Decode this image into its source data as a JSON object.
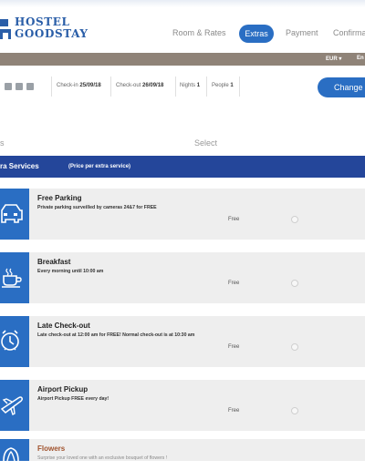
{
  "brand": {
    "line1": "HOSTEL",
    "line2": "GOODSTAY",
    "color": "#2a5ea8"
  },
  "nav": {
    "rooms": "Room & Rates",
    "extras": "Extras",
    "payment": "Payment",
    "confirm": "Confirma"
  },
  "topbar": {
    "currency": "EUR ▾",
    "language": "En"
  },
  "booking": {
    "checkin_label": "Check-in",
    "checkin_value": "25/09/18",
    "checkout_label": "Check-out",
    "checkout_value": "26/09/18",
    "nights_label": "Nights",
    "nights_value": "1",
    "people_label": "People",
    "people_value": "1",
    "change_label": "Change"
  },
  "columns": {
    "left": "s",
    "select": "Select"
  },
  "section": {
    "title": "ra Services",
    "subtitle": "(Price per extra service)"
  },
  "services": [
    {
      "icon": "car-icon",
      "title": "Free Parking",
      "desc": "Private parking surveilled by cameras 24&7 for FREE",
      "price": "Free"
    },
    {
      "icon": "coffee-icon",
      "title": "Breakfast",
      "desc": "Every morning until 10:00 am",
      "price": "Free"
    },
    {
      "icon": "alarm-clock-icon",
      "title": "Late Check-out",
      "desc": "Late check-out at 12:00 am for FREE! Normal check-out is at 10:30 am",
      "price": "Free"
    },
    {
      "icon": "airplane-icon",
      "title": "Airport Pickup",
      "desc": "Airport Pickup FREE every day!",
      "price": "Free"
    },
    {
      "icon": "flower-icon",
      "title": "Flowers",
      "desc": "Surprise your loved one with an exclusive bouquet of flowers !",
      "price": ""
    }
  ],
  "colors": {
    "primary": "#2a6ec3",
    "section": "#24469a",
    "brownbar": "#8f8378",
    "row": "#eeeeee"
  }
}
